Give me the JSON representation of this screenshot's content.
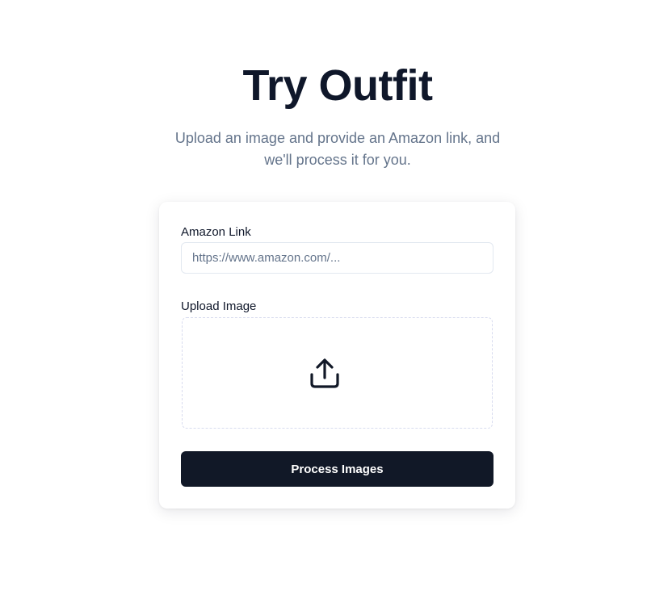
{
  "header": {
    "title": "Try Outfit",
    "subtitle": "Upload an image and provide an Amazon link, and we'll process it for you."
  },
  "form": {
    "amazon_link": {
      "label": "Amazon Link",
      "placeholder": "https://www.amazon.com/...",
      "value": ""
    },
    "upload_image": {
      "label": "Upload Image",
      "icon": "upload-icon"
    },
    "submit_label": "Process Images"
  },
  "colors": {
    "title": "#0f172a",
    "subtitle": "#64748b",
    "button_bg": "#111827",
    "button_text": "#ffffff",
    "input_border": "#e2e8f0",
    "dropzone_border": "#d8dcef"
  }
}
